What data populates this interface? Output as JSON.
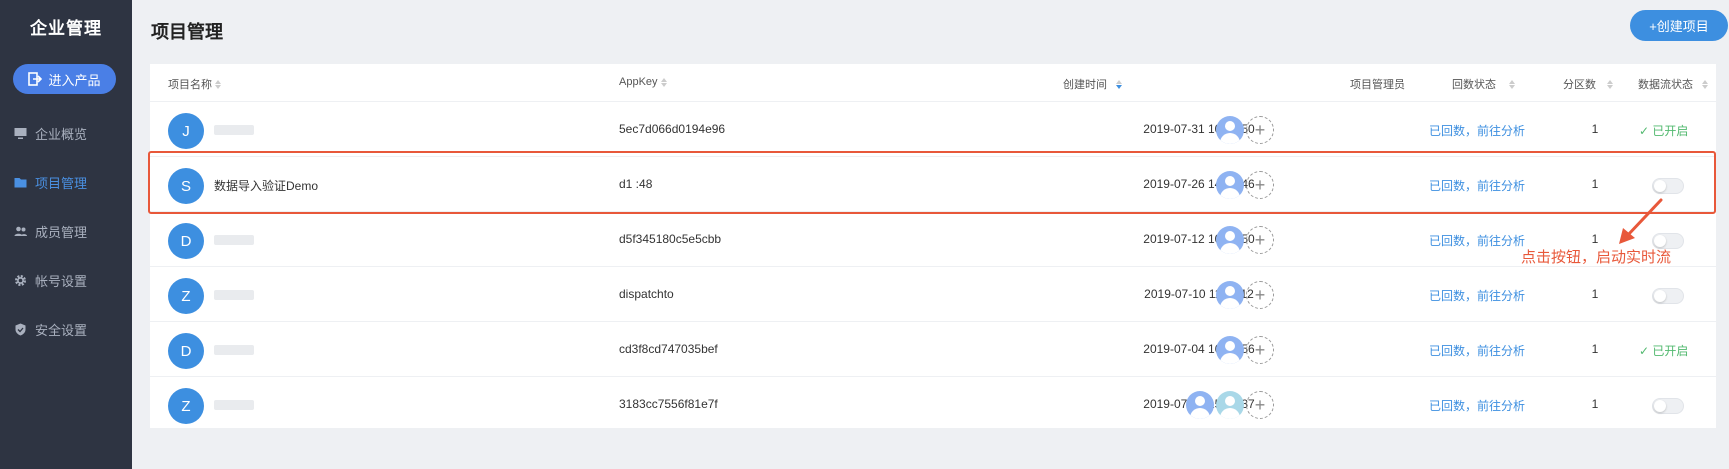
{
  "sidebar": {
    "brand": "企业管理",
    "enter_button": "进入产品",
    "items": [
      {
        "label": "企业概览",
        "icon": "monitor-icon",
        "active": false
      },
      {
        "label": "项目管理",
        "icon": "folder-icon",
        "active": true
      },
      {
        "label": "成员管理",
        "icon": "users-icon",
        "active": false
      },
      {
        "label": "帐号设置",
        "icon": "gear-icon",
        "active": false
      },
      {
        "label": "安全设置",
        "icon": "shield-icon",
        "active": false
      }
    ]
  },
  "header": {
    "title": "项目管理",
    "create_button": "+创建项目"
  },
  "table": {
    "columns": {
      "name": "项目名称",
      "appkey": "AppKey",
      "created": "创建时间",
      "managers": "项目管理员",
      "backfill": "回数状态",
      "partitions": "分区数",
      "stream": "数据流状态"
    },
    "rows": [
      {
        "initial": "J",
        "name": "",
        "appkey": "5ec7d066d0194e96",
        "created": "2019-07-31 10:27:50",
        "managers": 1,
        "backfill": "已回数",
        "analyze": "前往分析",
        "partitions": "1",
        "stream_on": true
      },
      {
        "initial": "S",
        "name": "数据导入验证Demo",
        "appkey": "d1                    :48",
        "created": "2019-07-26 14:10:46",
        "managers": 1,
        "backfill": "已回数",
        "analyze": "前往分析",
        "partitions": "1",
        "stream_on": false
      },
      {
        "initial": "D",
        "name": "",
        "appkey": "d5f345180c5e5cbb",
        "created": "2019-07-12 10:04:50",
        "managers": 1,
        "backfill": "已回数",
        "analyze": "前往分析",
        "partitions": "1",
        "stream_on": false
      },
      {
        "initial": "Z",
        "name": "",
        "appkey": "dispatchto",
        "created": "2019-07-10 11:11:12",
        "managers": 1,
        "backfill": "已回数",
        "analyze": "前往分析",
        "partitions": "1",
        "stream_on": false
      },
      {
        "initial": "D",
        "name": "",
        "appkey": "cd3f8cd747035bef",
        "created": "2019-07-04 16:39:56",
        "managers": 1,
        "backfill": "已回数",
        "analyze": "前往分析",
        "partitions": "1",
        "stream_on": true
      },
      {
        "initial": "Z",
        "name": "",
        "appkey": "3183cc7556f81e7f",
        "created": "2019-07-04 15:15:37",
        "managers": 2,
        "backfill": "已回数",
        "analyze": "前往分析",
        "partitions": "1",
        "stream_on": false
      }
    ],
    "stream_on_label": "已开启"
  },
  "annotation": {
    "text": "点击按钮，启动实时流",
    "color": "#e8583a"
  },
  "colors": {
    "accent": "#3d8fe0",
    "sidebar_bg": "#2e3442",
    "success": "#52b96f"
  }
}
